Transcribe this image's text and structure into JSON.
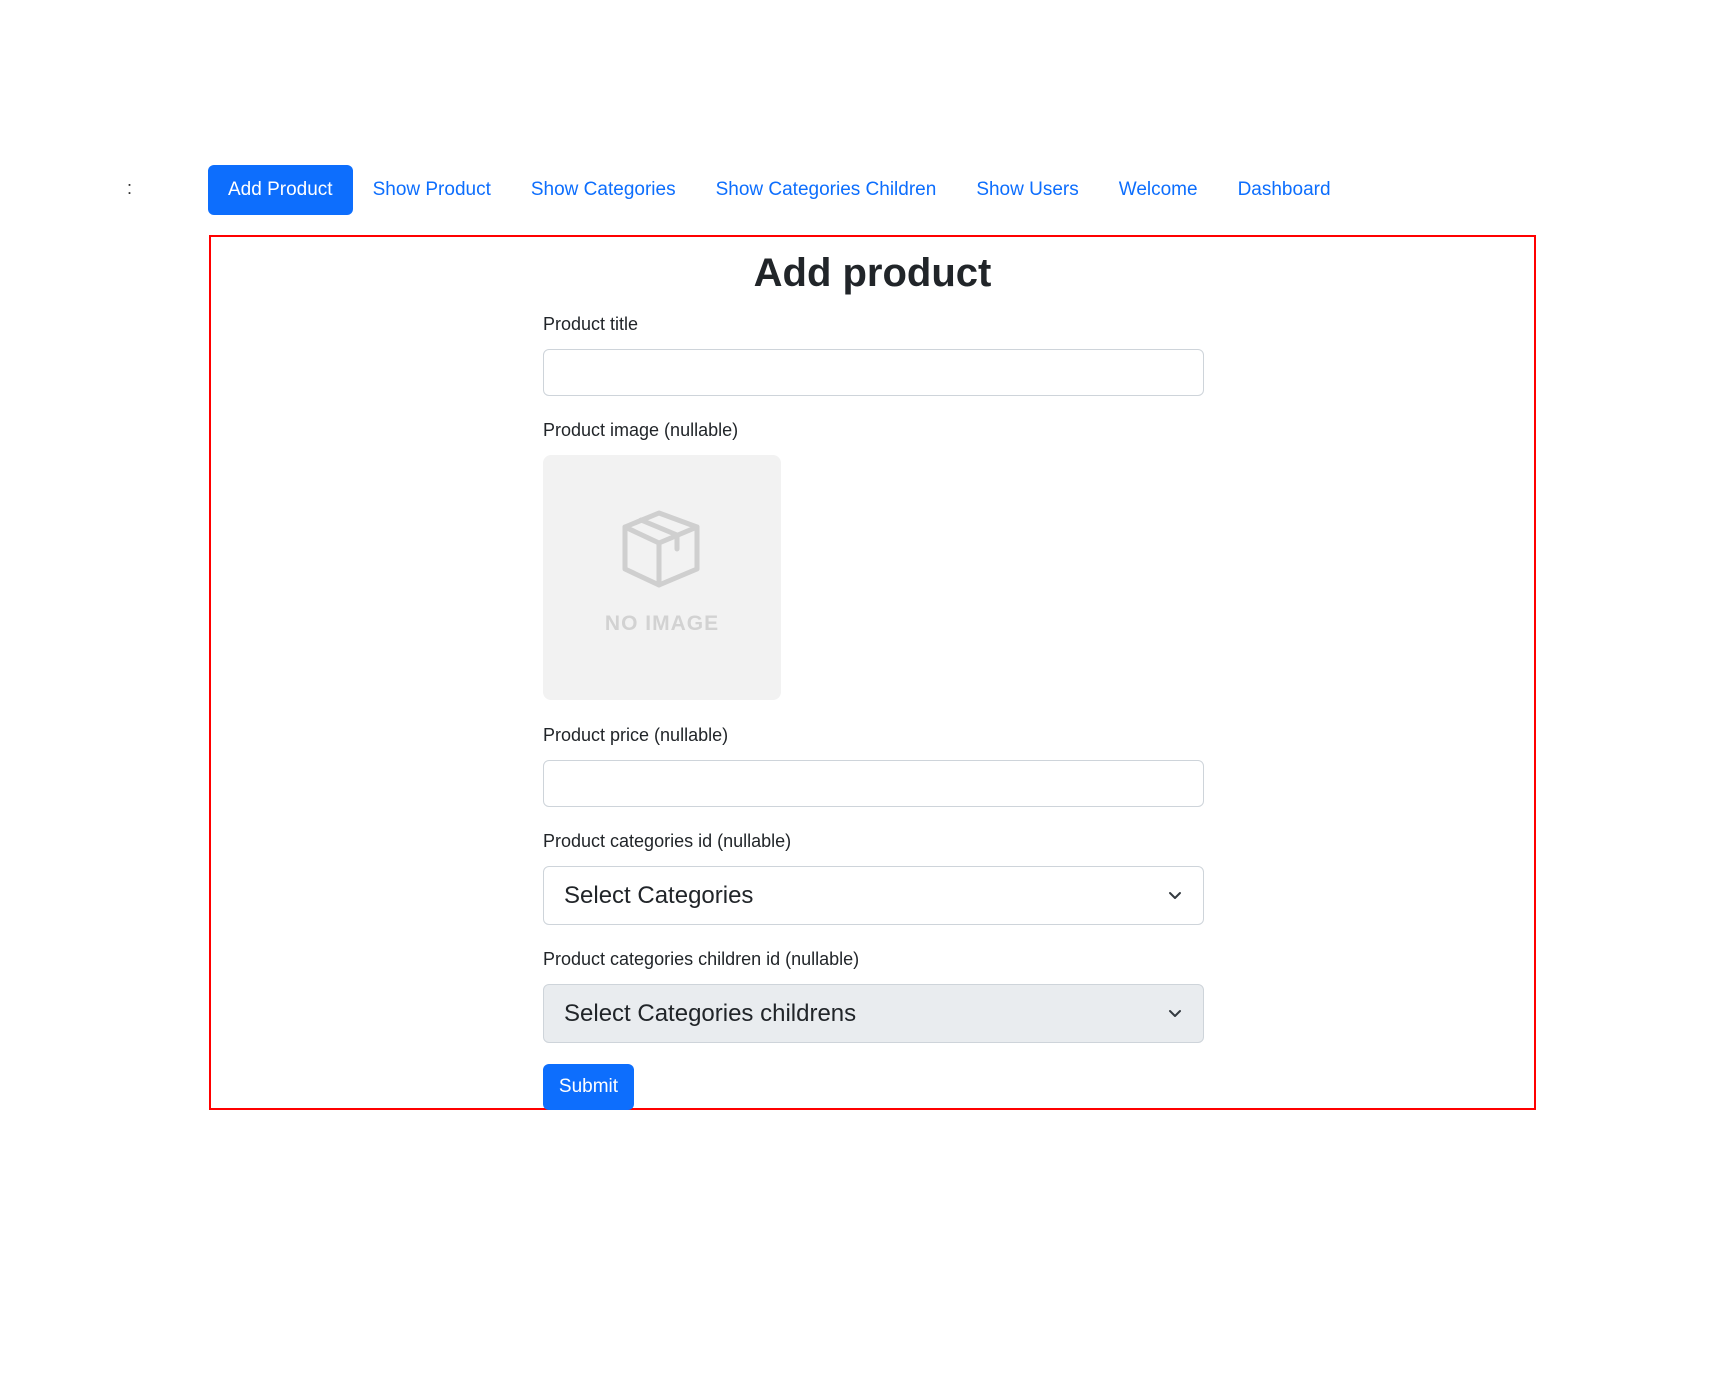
{
  "stray_text": ":",
  "nav": {
    "items": [
      {
        "label": "Add Product",
        "active": true
      },
      {
        "label": "Show Product",
        "active": false
      },
      {
        "label": "Show Categories",
        "active": false
      },
      {
        "label": "Show Categories Children",
        "active": false
      },
      {
        "label": "Show Users",
        "active": false
      },
      {
        "label": "Welcome",
        "active": false
      },
      {
        "label": "Dashboard",
        "active": false
      }
    ]
  },
  "form": {
    "title": "Add product",
    "product_title": {
      "label": "Product title",
      "value": ""
    },
    "product_image": {
      "label": "Product image (nullable)",
      "placeholder_text": "NO IMAGE",
      "placeholder_icon": "box-icon"
    },
    "product_price": {
      "label": "Product price (nullable)",
      "value": ""
    },
    "categories": {
      "label": "Product categories id (nullable)",
      "selected": "Select Categories"
    },
    "categories_children": {
      "label": "Product categories children id (nullable)",
      "selected": "Select Categories childrens",
      "disabled": true
    },
    "submit_label": "Submit"
  },
  "colors": {
    "primary": "#0d6efd",
    "frame_border": "#ff0000",
    "disabled_select_bg": "#e9ecef"
  }
}
